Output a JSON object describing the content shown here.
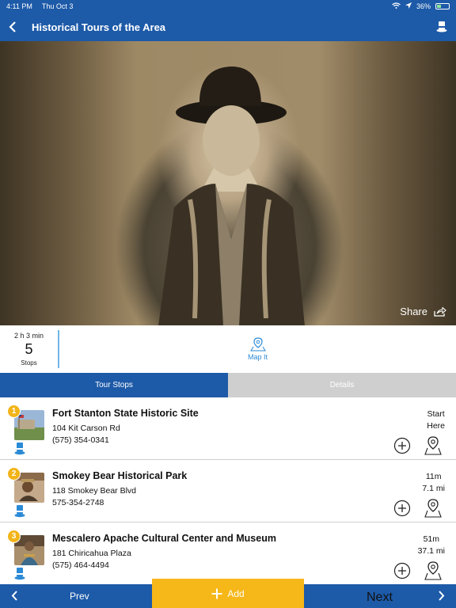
{
  "status": {
    "time": "4:11 PM",
    "date": "Thu Oct 3",
    "battery": "36%"
  },
  "nav": {
    "title": "Historical Tours of the Area"
  },
  "hero": {
    "share_label": "Share"
  },
  "stats": {
    "duration": "2 h 3 min",
    "stop_count": "5",
    "stops_label": "Stops",
    "map_label": "Map It"
  },
  "tabs": [
    {
      "label": "Tour Stops",
      "active": true
    },
    {
      "label": "Details",
      "active": false
    }
  ],
  "stops": [
    {
      "num": "1",
      "name": "Fort Stanton State Historic Site",
      "address": "104 Kit Carson Rd",
      "phone": "(575) 354-0341",
      "dist1": "Start",
      "dist2": "Here"
    },
    {
      "num": "2",
      "name": "Smokey Bear Historical Park",
      "address": "118 Smokey Bear Blvd",
      "phone": "575-354-2748",
      "dist1": "11m",
      "dist2": "7.1 mi"
    },
    {
      "num": "3",
      "name": "Mescalero Apache Cultural Center and Museum",
      "address": "181 Chiricahua Plaza",
      "phone": "(575) 464-4494",
      "dist1": "51m",
      "dist2": "37.1 mi"
    }
  ],
  "bottom": {
    "prev": "Prev",
    "add": "Add",
    "next": "Next"
  },
  "colors": {
    "primary": "#1d5aa8",
    "accent": "#f6b719",
    "link": "#2a8ad6"
  }
}
